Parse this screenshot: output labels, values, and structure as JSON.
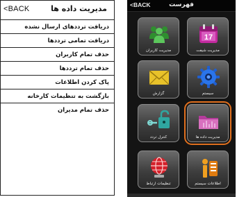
{
  "left": {
    "back_label": "<BACK",
    "title": "مدیریت داده ها",
    "items": [
      {
        "label": "دریافت ترددهای ارسال نشده"
      },
      {
        "label": "دریافت تمامی ترددها"
      },
      {
        "label": "حذف تمام کاربران"
      },
      {
        "label": "حذف تمام ترددها"
      },
      {
        "label": "پاک کردن اطلاعات"
      },
      {
        "label": "بازگشت به تنظیمات کارخانه"
      },
      {
        "label": "حذف تمام مدیران"
      }
    ]
  },
  "right": {
    "back_label": "<BACK",
    "title": "فهرست",
    "highlight_color": "#e1701e",
    "tiles": [
      {
        "label": "مدیریت شیفت",
        "icon": "calendar-icon"
      },
      {
        "label": "مدیریت کاربران",
        "icon": "users-icon"
      },
      {
        "label": "سیستم",
        "icon": "gear-icon"
      },
      {
        "label": "گزارش",
        "icon": "envelope-icon"
      },
      {
        "label": "مدیریت داده ها",
        "icon": "folder-icon"
      },
      {
        "label": "کنترل تردد",
        "icon": "lock-key-icon"
      },
      {
        "label": "اطلاعات سیستم",
        "icon": "info-icon"
      },
      {
        "label": "تنظیمات ارتباط",
        "icon": "globe-icon"
      }
    ]
  }
}
